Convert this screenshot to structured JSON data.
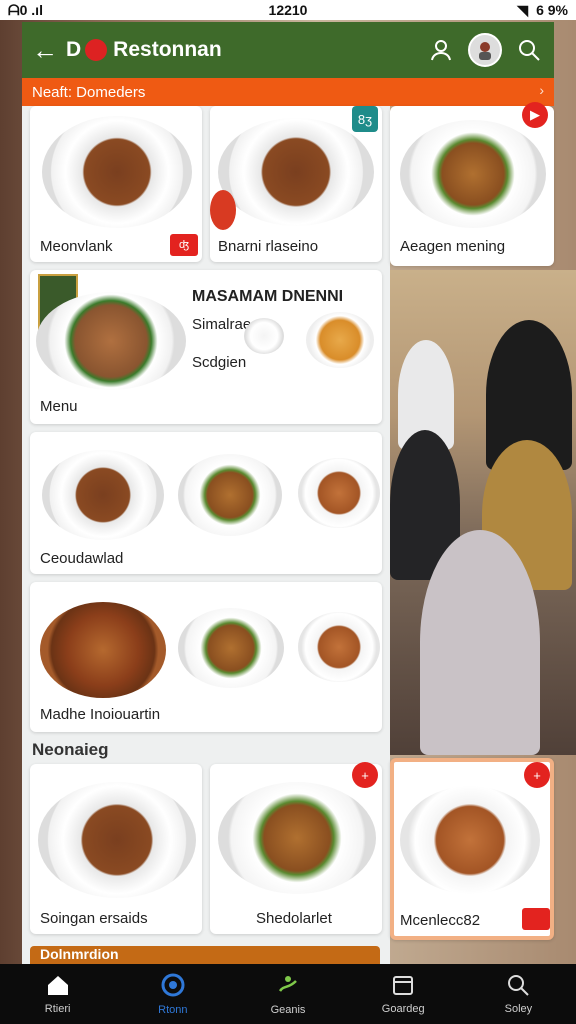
{
  "status_bar": {
    "left": "ᗩ0 .ıl",
    "time": "12210",
    "battery": "6 9%"
  },
  "header": {
    "title": "Restonnan",
    "logo_letter": "D"
  },
  "banner": {
    "label": "Neaft: Domeders"
  },
  "top_row": [
    {
      "caption": "Meonvlank",
      "tag": "ʤ"
    },
    {
      "caption": "Bnarni rlaseino",
      "tag": "8ʒ"
    },
    {
      "caption": "Aeagen mening",
      "tag": "▶"
    }
  ],
  "feature_card": {
    "title": "MASAMAM DNENNI",
    "line1": "Simalrae",
    "line2": "Scdgien",
    "footer": "Menu"
  },
  "grid_card_1": {
    "caption": "Ceoudawlad"
  },
  "grid_card_2": {
    "caption": "Madhe Inoiouartin"
  },
  "section": {
    "title": "Neonaieg"
  },
  "bottom_row": [
    {
      "caption": "Soingan ersaids"
    },
    {
      "caption": "Shedolarlet"
    },
    {
      "caption": "Mcenlecc82"
    }
  ],
  "partial_strip": {
    "label": "Dolnmrdion"
  },
  "nav": [
    {
      "label": "Rtieri",
      "icon": "home-icon",
      "active": false
    },
    {
      "label": "Rtonn",
      "icon": "compass-icon",
      "active": true
    },
    {
      "label": "Geanis",
      "icon": "chef-icon",
      "active": false
    },
    {
      "label": "Goardeg",
      "icon": "calendar-icon",
      "active": false
    },
    {
      "label": "Soley",
      "icon": "search-icon",
      "active": false
    }
  ],
  "colors": {
    "header": "#3e6a2a",
    "banner": "#ef5a13",
    "accent": "#e3231f",
    "active_nav": "#2f78d8"
  }
}
